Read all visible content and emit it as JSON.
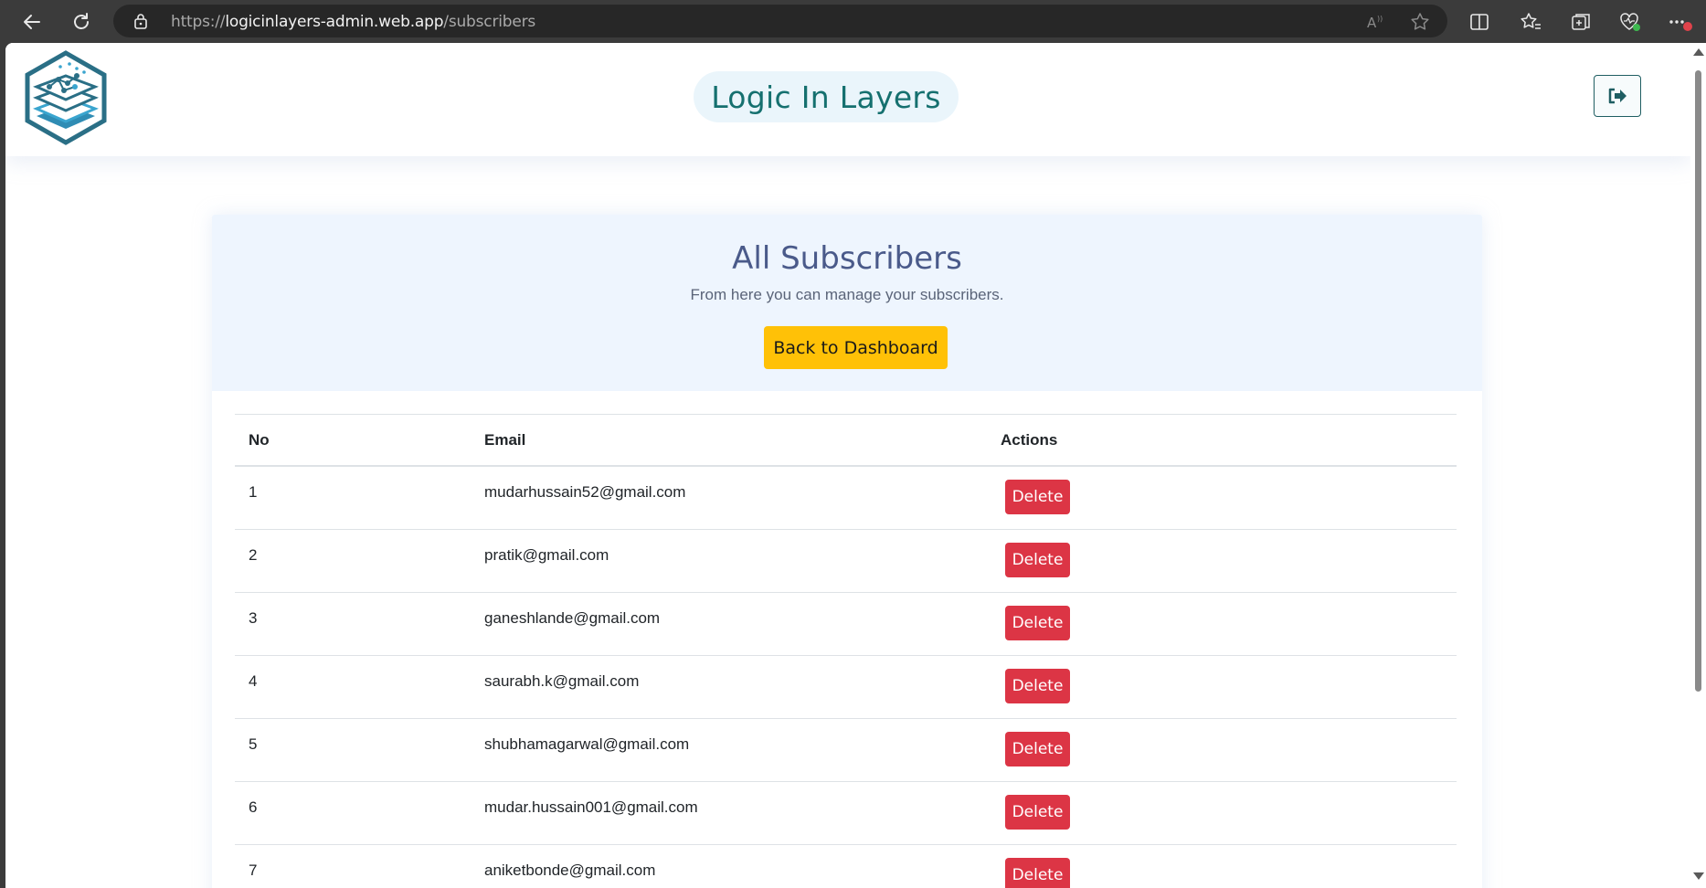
{
  "browser": {
    "url_prefix": "https://",
    "url_host": "logicinlayers-admin.web.app",
    "url_path": "/subscribers"
  },
  "header": {
    "brand": "Logic In Layers"
  },
  "hero": {
    "title": "All Subscribers",
    "subtitle": "From here you can manage your subscribers.",
    "back_label": "Back to Dashboard"
  },
  "table": {
    "columns": [
      "No",
      "Email",
      "Actions"
    ],
    "rows": [
      {
        "no": "1",
        "email": "mudarhussain52@gmail.com",
        "action": "Delete"
      },
      {
        "no": "2",
        "email": "pratik@gmail.com",
        "action": "Delete"
      },
      {
        "no": "3",
        "email": "ganeshlande@gmail.com",
        "action": "Delete"
      },
      {
        "no": "4",
        "email": "saurabh.k@gmail.com",
        "action": "Delete"
      },
      {
        "no": "5",
        "email": "shubhamagarwal@gmail.com",
        "action": "Delete"
      },
      {
        "no": "6",
        "email": "mudar.hussain001@gmail.com",
        "action": "Delete"
      },
      {
        "no": "7",
        "email": "aniketbonde@gmail.com",
        "action": "Delete"
      }
    ]
  },
  "colors": {
    "brand_teal": "#15706f",
    "accent_yellow": "#ffc107",
    "danger_red": "#dc3545",
    "hero_bg": "#eef5fe"
  },
  "icons": [
    "back-arrow-icon",
    "refresh-icon",
    "lock-icon",
    "read-aloud-icon",
    "favorite-star-icon",
    "split-screen-icon",
    "favorites-icon",
    "collections-icon",
    "browser-health-icon",
    "more-icon",
    "logout-icon"
  ]
}
